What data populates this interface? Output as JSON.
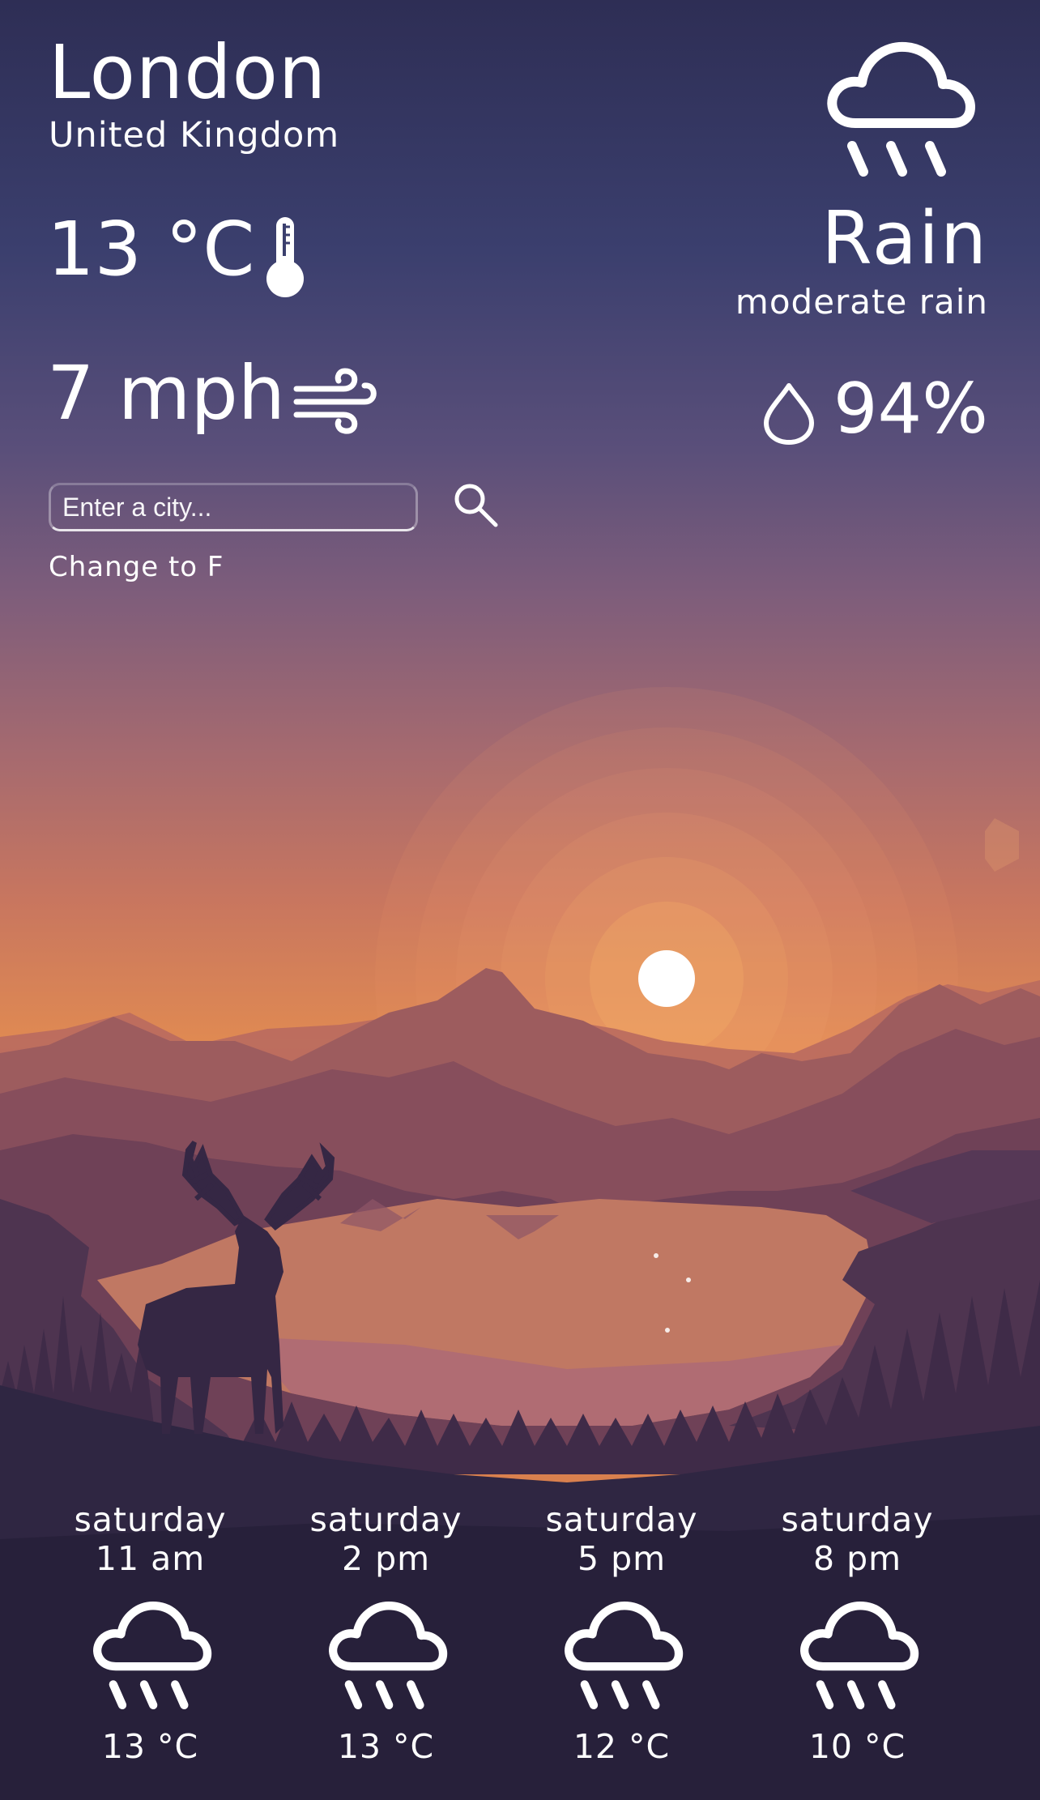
{
  "location": {
    "city": "London",
    "country": "United Kingdom"
  },
  "current": {
    "temperature": "13 °C",
    "wind": "7 mph",
    "condition": "Rain",
    "description": "moderate rain",
    "humidity": "94%",
    "icons": {
      "condition": "cloud-rain-icon",
      "temperature": "thermometer-icon",
      "wind": "wind-icon",
      "humidity": "droplet-icon"
    }
  },
  "search": {
    "placeholder": "Enter a city...",
    "button_icon": "search-icon"
  },
  "unit_toggle": "Change to F",
  "forecast": [
    {
      "day": "saturday",
      "time": "11 am",
      "temp": "13 °C",
      "icon": "cloud-rain-icon"
    },
    {
      "day": "saturday",
      "time": "2 pm",
      "temp": "13 °C",
      "icon": "cloud-rain-icon"
    },
    {
      "day": "saturday",
      "time": "5 pm",
      "temp": "12 °C",
      "icon": "cloud-rain-icon"
    },
    {
      "day": "saturday",
      "time": "8 pm",
      "temp": "10 °C",
      "icon": "cloud-rain-icon"
    }
  ],
  "colors": {
    "sky_top": "#2e2e55",
    "sky_mid": "#a66a6f",
    "horizon": "#e08a52",
    "foreground": "#2b2440",
    "text": "#ffffff"
  }
}
